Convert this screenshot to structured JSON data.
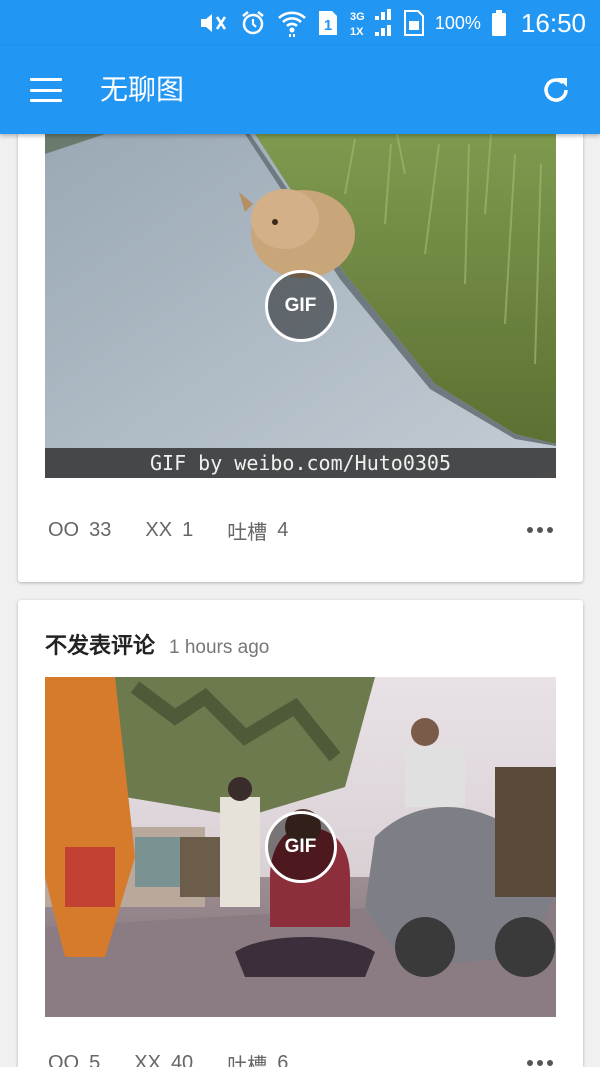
{
  "status_bar": {
    "icons": [
      "mute-icon",
      "alarm-icon",
      "wifi-icon",
      "sim1-icon",
      "network-3g-1x-icon",
      "sim2-icon",
      "battery-icon"
    ],
    "network_top": "3G",
    "network_bottom": "1X",
    "sim_label": "1",
    "battery": "100%",
    "time": "16:50"
  },
  "app_bar": {
    "title": "无聊图",
    "menu_icon": "hamburger-menu-icon",
    "refresh_icon": "refresh-icon",
    "color": "#2196f3"
  },
  "posts": [
    {
      "media_badge": "GIF",
      "watermark": "GIF by weibo.com/Huto0305",
      "oo_label": "OO",
      "oo_count": "33",
      "xx_label": "XX",
      "xx_count": "1",
      "comment_label": "吐槽",
      "comment_count": "4"
    },
    {
      "author": "不发表评论",
      "time": "1 hours ago",
      "media_badge": "GIF",
      "oo_label": "OO",
      "oo_count": "5",
      "xx_label": "XX",
      "xx_count": "40",
      "comment_label": "吐槽",
      "comment_count": "6"
    }
  ]
}
